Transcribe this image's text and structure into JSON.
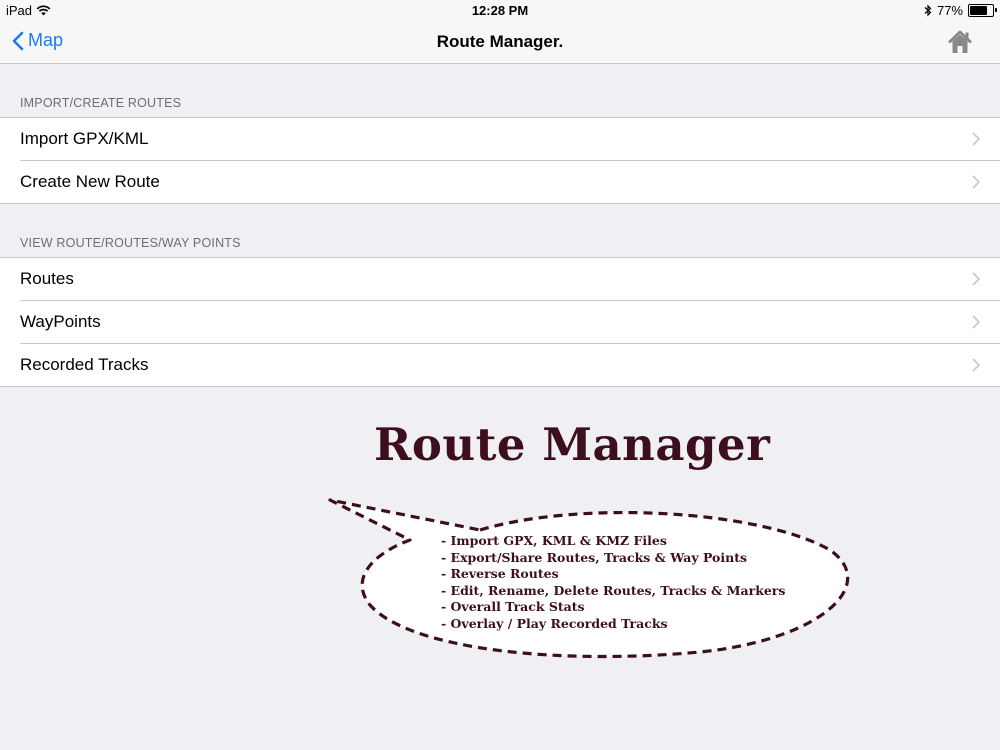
{
  "status_bar": {
    "device": "iPad",
    "time": "12:28 PM",
    "battery": "77%",
    "battery_level": 0.77
  },
  "nav": {
    "back_label": "Map",
    "title": "Route Manager.",
    "home_icon": "home-icon"
  },
  "sections": [
    {
      "header": "IMPORT/CREATE ROUTES",
      "rows": [
        {
          "label": "Import GPX/KML"
        },
        {
          "label": "Create New Route"
        }
      ]
    },
    {
      "header": "VIEW ROUTE/ROUTES/WAY POINTS",
      "rows": [
        {
          "label": "Routes"
        },
        {
          "label": "WayPoints"
        },
        {
          "label": "Recorded Tracks"
        }
      ]
    }
  ],
  "promo": {
    "title": "Route Manager",
    "features": [
      "- Import GPX, KML & KMZ Files",
      "- Export/Share Routes, Tracks & Way Points",
      "- Reverse Routes",
      "- Edit, Rename, Delete Routes, Tracks & Markers",
      "- Overall Track Stats",
      "- Overlay / Play Recorded Tracks"
    ]
  },
  "colors": {
    "accent": "#1a7cf4",
    "background": "#efeff4",
    "promo_text": "#3d0f1d"
  }
}
